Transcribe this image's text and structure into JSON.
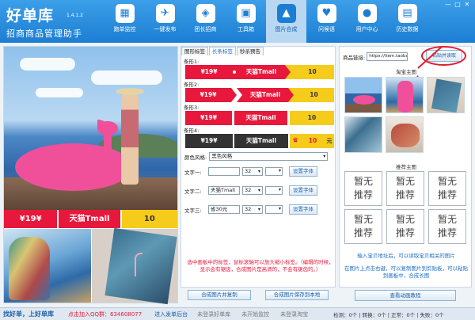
{
  "app": {
    "name": "好单库",
    "version": "1.4.1.2",
    "subtitle": "招商商品管理助手",
    "window_buttons": [
      "—",
      "□",
      "✕"
    ]
  },
  "nav": [
    {
      "label": "跑单监控",
      "icon": "monitor-icon",
      "glyph": "▦"
    },
    {
      "label": "一键发布",
      "icon": "publish-icon",
      "glyph": "✈"
    },
    {
      "label": "团长招商",
      "icon": "tag-icon",
      "glyph": "◈"
    },
    {
      "label": "工具箱",
      "icon": "toolbox-icon",
      "glyph": "▣"
    },
    {
      "label": "图片合成",
      "icon": "image-icon",
      "glyph": "▲",
      "active": true
    },
    {
      "label": "问候语",
      "icon": "chat-icon",
      "glyph": "♥"
    },
    {
      "label": "用户中心",
      "icon": "user-icon",
      "glyph": "●"
    },
    {
      "label": "历史数据",
      "icon": "history-icon",
      "glyph": "▤"
    }
  ],
  "preview": {
    "price": "¥19¥",
    "shop": "天猫Tmall",
    "coupon": "10"
  },
  "tabs": [
    "图形标签",
    "长条标签",
    "秒杀预告"
  ],
  "styles": [
    {
      "label": "条形1:",
      "price": "¥19¥",
      "shop": "天猫Tmall",
      "coupon": "10"
    },
    {
      "label": "条形2:",
      "price": "¥19¥",
      "shop": "天猫Tmall",
      "coupon": "10"
    },
    {
      "label": "条形3:",
      "price": "¥19¥",
      "shop": "天猫Tmall",
      "coupon": "10"
    },
    {
      "label": "条形4:",
      "price": "¥19¥",
      "shop": "天猫Tmall",
      "tag": "省",
      "coupon": "10",
      "unit": "元"
    }
  ],
  "color_style": {
    "label": "颜色风格:",
    "value": "黑色风格"
  },
  "text_rows": [
    {
      "label": "文字一:",
      "value": "",
      "size": "32",
      "button": "设置字体"
    },
    {
      "label": "文字二:",
      "value": "天猫Tmall",
      "size": "32",
      "button": "设置字体"
    },
    {
      "label": "文字三:",
      "value": "省30元",
      "size": "32",
      "button": "设置字体"
    }
  ],
  "warning": "选中画板中的标签，鼠标滚轴可以放大缩小标签。（编辑的时候，显示会有锯齿，合成图片是高清的，不会有锯齿的。）",
  "mid_actions": [
    "合成图片并复制",
    "合成图片保存到本地"
  ],
  "right": {
    "url_label": "商品链接:",
    "url_value": "https://item.taobao",
    "paste_button": "粘贴并读取",
    "main_images_title": "淘宝主图",
    "recommend_title": "推荐主图",
    "recommend_cells": [
      {
        "line1": "暂无",
        "line2": "推荐"
      },
      {
        "line1": "暂无",
        "line2": "推荐"
      },
      {
        "line1": "暂无",
        "line2": "推荐"
      },
      {
        "line1": "暂无",
        "line2": "推荐"
      },
      {
        "line1": "暂无",
        "line2": "推荐"
      },
      {
        "line1": "暂无",
        "line2": "推荐"
      }
    ],
    "hint1": "输入宝贝地址后，可以读取宝贝相关的图片",
    "hint2": "在图片上点击右键，可以复制图片到剪贴板，可以粘贴到画板中，合成长图",
    "tutorial_button": "查看动画教程"
  },
  "status": {
    "slogan": "找好单，上好单库",
    "qq": "点击加入QQ群：634608077",
    "backend": "进入发单后台",
    "items": [
      "未登录好单库",
      "未开始监控",
      "未登录淘宝"
    ],
    "stats": "检测：0个 | 转换：0个 | 正常：0个 | 失败：0个"
  },
  "colors": {
    "accent": "#1c7ed3",
    "red": "#e8183c",
    "yellow": "#f5cc1b",
    "dark": "#333333"
  }
}
